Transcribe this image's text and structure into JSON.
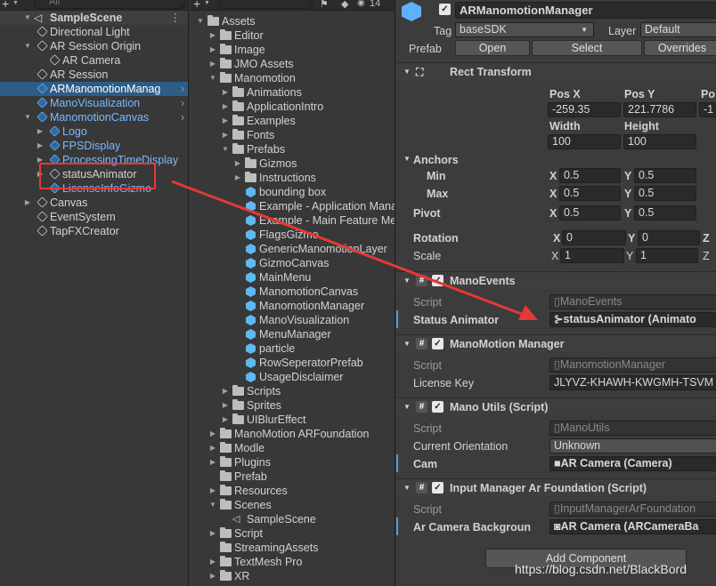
{
  "hierarchy": {
    "search_placeholder": "All",
    "scene": "SampleScene",
    "items": [
      {
        "label": "Directional Light"
      },
      {
        "label": "AR Session Origin"
      },
      {
        "label": "AR Camera"
      },
      {
        "label": "AR Session"
      },
      {
        "label": "ARManomotionManag"
      },
      {
        "label": "ManoVisualization"
      },
      {
        "label": "ManomotionCanvas"
      },
      {
        "label": "Logo"
      },
      {
        "label": "FPSDisplay"
      },
      {
        "label": "ProcessingTimeDisplay"
      },
      {
        "label": "statusAnimator"
      },
      {
        "label": "LicenseInfoGizmo"
      },
      {
        "label": "Canvas"
      },
      {
        "label": "EventSystem"
      },
      {
        "label": "TapFXCreator"
      }
    ]
  },
  "project": {
    "search_count": "14",
    "items": [
      {
        "label": "Assets"
      },
      {
        "label": "Editor"
      },
      {
        "label": "Image"
      },
      {
        "label": "JMO Assets"
      },
      {
        "label": "Manomotion"
      },
      {
        "label": "Animations"
      },
      {
        "label": "ApplicationIntro"
      },
      {
        "label": "Examples"
      },
      {
        "label": "Fonts"
      },
      {
        "label": "Prefabs"
      },
      {
        "label": "Gizmos"
      },
      {
        "label": "Instructions"
      },
      {
        "label": "bounding box"
      },
      {
        "label": "Example - Application Mana"
      },
      {
        "label": "Example - Main Feature Me"
      },
      {
        "label": "FlagsGizmo"
      },
      {
        "label": "GenericManomotionLayer"
      },
      {
        "label": "GizmoCanvas"
      },
      {
        "label": "MainMenu"
      },
      {
        "label": "ManomotionCanvas"
      },
      {
        "label": "ManomotionManager"
      },
      {
        "label": "ManoVisualization"
      },
      {
        "label": "MenuManager"
      },
      {
        "label": "particle"
      },
      {
        "label": "RowSeperatorPrefab"
      },
      {
        "label": "UsageDisclaimer"
      },
      {
        "label": "Scripts"
      },
      {
        "label": "Sprites"
      },
      {
        "label": "UIBlurEffect"
      },
      {
        "label": "ManoMotion ARFoundation"
      },
      {
        "label": "Modle"
      },
      {
        "label": "Plugins"
      },
      {
        "label": "Prefab"
      },
      {
        "label": "Resources"
      },
      {
        "label": "Scenes"
      },
      {
        "label": "SampleScene"
      },
      {
        "label": "Script"
      },
      {
        "label": "StreamingAssets"
      },
      {
        "label": "TextMesh Pro"
      },
      {
        "label": "XR"
      }
    ]
  },
  "inspector": {
    "object_name": "ARManomotionManager",
    "tag_label": "Tag",
    "tag_value": "baseSDK",
    "layer_label": "Layer",
    "layer_value": "Default",
    "prefab_label": "Prefab",
    "open": "Open",
    "select": "Select",
    "overrides": "Overrides",
    "rect": {
      "title": "Rect Transform",
      "posx_label": "Pos X",
      "posy_label": "Pos Y",
      "posz_label": "Po",
      "posx": "-259.35",
      "posy": "221.7786",
      "posz": "-1",
      "width_label": "Width",
      "height_label": "Height",
      "width": "100",
      "height": "100",
      "anchors": "Anchors",
      "min": "Min",
      "max": "Max",
      "pivot": "Pivot",
      "x": "X",
      "y": "Y",
      "z": "Z",
      "min_x": "0.5",
      "min_y": "0.5",
      "max_x": "0.5",
      "max_y": "0.5",
      "pivot_x": "0.5",
      "pivot_y": "0.5",
      "rotation": "Rotation",
      "rot_x": "0",
      "rot_y": "0",
      "scale": "Scale",
      "scale_x": "1",
      "scale_y": "1"
    },
    "mano_events": {
      "title": "ManoEvents",
      "script_label": "Script",
      "script": "ManoEvents",
      "field_label": "Status Animator",
      "field_value": "statusAnimator (Animato"
    },
    "mano_manager": {
      "title": "ManoMotion Manager",
      "script_label": "Script",
      "script": "ManomotionManager",
      "key_label": "License Key",
      "key_value": "JLYVZ-KHAWH-KWGMH-TSVM"
    },
    "mano_utils": {
      "title": "Mano Utils (Script)",
      "script_label": "Script",
      "script": "ManoUtils",
      "orient_label": "Current Orientation",
      "orient_value": "Unknown",
      "cam_label": "Cam",
      "cam_value": "AR Camera (Camera)"
    },
    "input_manager": {
      "title": "Input Manager Ar Foundation (Script)",
      "script_label": "Script",
      "script": "InputManagerArFoundation",
      "bg_label": "Ar Camera Backgroun",
      "bg_value": "AR Camera (ARCameraBa"
    },
    "add_component": "Add Component"
  },
  "watermark": "https://blog.csdn.net/BlackBord",
  "highlight_color": "#e53935"
}
